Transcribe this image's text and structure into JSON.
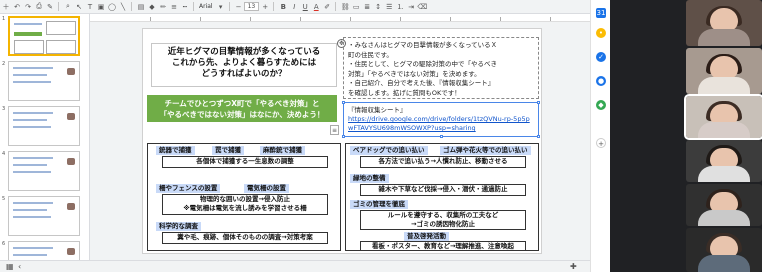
{
  "toolbar": {
    "font_name": "Arial",
    "font_size": "13",
    "bold": "B",
    "italic": "I",
    "underline": "U",
    "text_color": "A"
  },
  "filmstrip": {
    "slide_numbers": [
      "1",
      "2",
      "3",
      "4",
      "5",
      "6"
    ]
  },
  "slide": {
    "title_lines": [
      "近年ヒグマの目撃情報が多くなっている",
      "これから先、よりよく暮らすためには",
      "どうすればよいのか？"
    ],
    "banner_lines": [
      "チームでひとつずつX町で「やるべき対策」と",
      "「やるべきではない対策」はなにか、決めよう！"
    ],
    "notes_lines": [
      "・みなさんはヒグマの目撃情報が多くなっているＸ",
      "町の住民です。",
      "・住民として、ヒグマの駆除対策の中で「やるべき",
      "対策」「やるべきではない対策」を決めます。",
      "・自己紹介、自分で考えた後、『情報収集シート』",
      "を確認します。拡げに質問もOKです！"
    ],
    "link_label": "『情報収集シート』",
    "link_url": "https://drive.google.com/drive/folders/1tzQVNu-rp-5p5pwFTAVYSU698mWSOWXP?usp=sharing",
    "left_panel": {
      "tags_row1": [
        "銃器で捕獲",
        "罠で捕獲",
        "麻酔銃で捕獲"
      ],
      "box1": "各個体で捕獲する一生息数の調整",
      "tags_row2": [
        "柵やフェンスの設置",
        "電気柵の設置"
      ],
      "box2_lines": [
        "物理的な囲いの設置→侵入防止",
        "※電気柵は電気を流し誘みを学習させる柵"
      ],
      "tag_row3": "科学的な調査",
      "box3": "糞や毛、痕跡、個体そのものの調査→対策考案"
    },
    "right_panel": {
      "tags_row1": [
        "ベアドッグでの追い払い",
        "ゴム弾や花火等での追い払い"
      ],
      "box1": "各方法で追い払う→人慣れ防止、移動させる",
      "tag_row2": "緑地の整備",
      "box2": "雑木や下草など伐採→侵入・潜伏・通過防止",
      "tag_row3": "ゴミの管理を徹底",
      "box3_lines": [
        "ルールを遵守する、収集所の工夫など",
        "→ゴミの誘因物化防止"
      ],
      "tag_row4": "普及啓発活動",
      "box4": "看板・ポスター、教育など→理解推進、注意喚起"
    }
  },
  "sidebar_icons": [
    "calendar-icon",
    "keep-icon",
    "tasks-icon",
    "contacts-icon",
    "maps-icon",
    "add-icon"
  ],
  "participants": [
    {
      "name": "participant-1",
      "hair": "#3a2a22",
      "body": "#9e8f88",
      "bg": "#5f5048"
    },
    {
      "name": "participant-2",
      "hair": "#2b1d17",
      "body": "#e9e3dc",
      "bg": "#a79a90"
    },
    {
      "name": "participant-3",
      "hair": "#3c2c24",
      "body": "#d7ccc8",
      "bg": "#c8c0b8"
    },
    {
      "name": "participant-4",
      "hair": "#1f1a17",
      "body": "#e0e0e0",
      "bg": "#3c3c3c"
    },
    {
      "name": "participant-5",
      "hair": "#2e221c",
      "body": "#c9c9c9",
      "bg": "#303030"
    },
    {
      "name": "participant-6",
      "hair": "#3a2d26",
      "body": "#5d6b7a",
      "bg": "#2a2a2a"
    }
  ]
}
